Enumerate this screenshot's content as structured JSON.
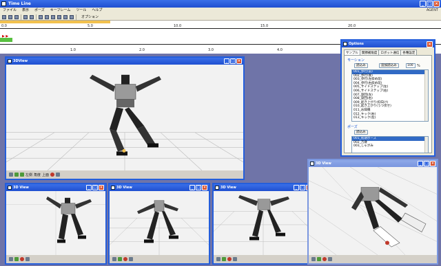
{
  "main": {
    "title": "Time Line",
    "agent": "AGENT",
    "menu": [
      "ファイル",
      "表示",
      "ポーズ",
      "キーフレーム",
      "ツール",
      "ヘルプ"
    ],
    "toolbar_label": "オプション",
    "timeline_ticks_top": [
      "0.0",
      "5.0",
      "10.0",
      "15.0",
      "20.0"
    ],
    "timeline_ticks_bottom": [
      "1.0",
      "2.0",
      "3.0",
      "4.0"
    ],
    "progress_fraction": 0.25
  },
  "views": {
    "v1": {
      "title": "3DView",
      "status_a": "左側",
      "status_b": "角度",
      "status_c": "上面"
    },
    "v2": {
      "title": "3D View"
    },
    "v3": {
      "title": "3D View"
    },
    "v4": {
      "title": "3D View"
    },
    "v5": {
      "title": "3D View"
    }
  },
  "options": {
    "title": "Options",
    "tabs": [
      "サンプル",
      "関節補角度",
      "ロボット通信",
      "各種設定"
    ],
    "motion_group": "モーション",
    "load_btn": "読込み",
    "add_load_btn": "追加読込み",
    "percent_value": "100",
    "percent_unit": "%",
    "motions": [
      "001_歩行(前)",
      "002_歩行(後)",
      "003_歩行(左斜め前)",
      "004_歩行(右斜め前)",
      "005_サイドステップ(左)",
      "006_サイドステップ(右)",
      "007_旋回(左)",
      "008_旋回(右)",
      "009_起き上がり(仰向け)",
      "010_起き上がり(うつ伏せ)",
      "011_お辞儀",
      "012_キック(右)",
      "013_キック(左)"
    ],
    "pose_group": "ポーズ",
    "pose_load_btn": "読込み",
    "poses": [
      "001_初期ポーズ",
      "002_万歳",
      "003_しゃがみ"
    ]
  },
  "colors": {
    "desktop": "#6f74a8",
    "titlebar": "#245edb",
    "timeline_progress": "#f2c14e"
  }
}
